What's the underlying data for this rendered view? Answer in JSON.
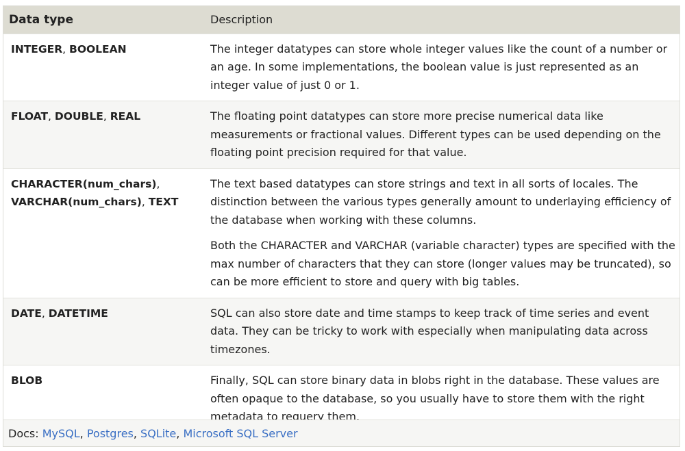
{
  "header": {
    "type_label": "Data type",
    "desc_label": "Description"
  },
  "rows": [
    {
      "types": [
        "INTEGER",
        "BOOLEAN"
      ],
      "desc": [
        "The integer datatypes can store whole integer values like the count of a number or an age. In some implementations, the boolean value is just represented as an integer value of just 0 or 1."
      ]
    },
    {
      "types": [
        "FLOAT",
        "DOUBLE",
        "REAL"
      ],
      "desc": [
        "The floating point datatypes can store more precise numerical data like measurements or fractional values. Different types can be used depending on the floating point precision required for that value."
      ]
    },
    {
      "types": [
        "CHARACTER(num_chars)",
        "VARCHAR(num_chars)",
        "TEXT"
      ],
      "desc": [
        "The text based datatypes can store strings and text in all sorts of locales. The distinction between the various types generally amount to underlaying efficiency of the database when working with these columns.",
        "Both the CHARACTER and VARCHAR (variable character) types are specified with the max number of characters that they can store (longer values may be truncated), so can be more efficient to store and query with big tables."
      ]
    },
    {
      "types": [
        "DATE",
        "DATETIME"
      ],
      "desc": [
        "SQL can also store date and time stamps to keep track of time series and event data. They can be tricky to work with especially when manipulating data across timezones."
      ]
    },
    {
      "types": [
        "BLOB"
      ],
      "desc": [
        "Finally, SQL can store binary data in blobs right in the database. These values are often opaque to the database, so you usually have to store them with the right metadata to requery them."
      ]
    }
  ],
  "separator": ", ",
  "docs": {
    "label": "Docs: ",
    "links": [
      "MySQL",
      "Postgres",
      "SQLite",
      "Microsoft SQL Server"
    ],
    "link_separator": ", "
  },
  "colors": {
    "header_bg": "#dddcd2",
    "alt_row_bg": "#f6f6f4",
    "link": "#3a6fc4"
  }
}
